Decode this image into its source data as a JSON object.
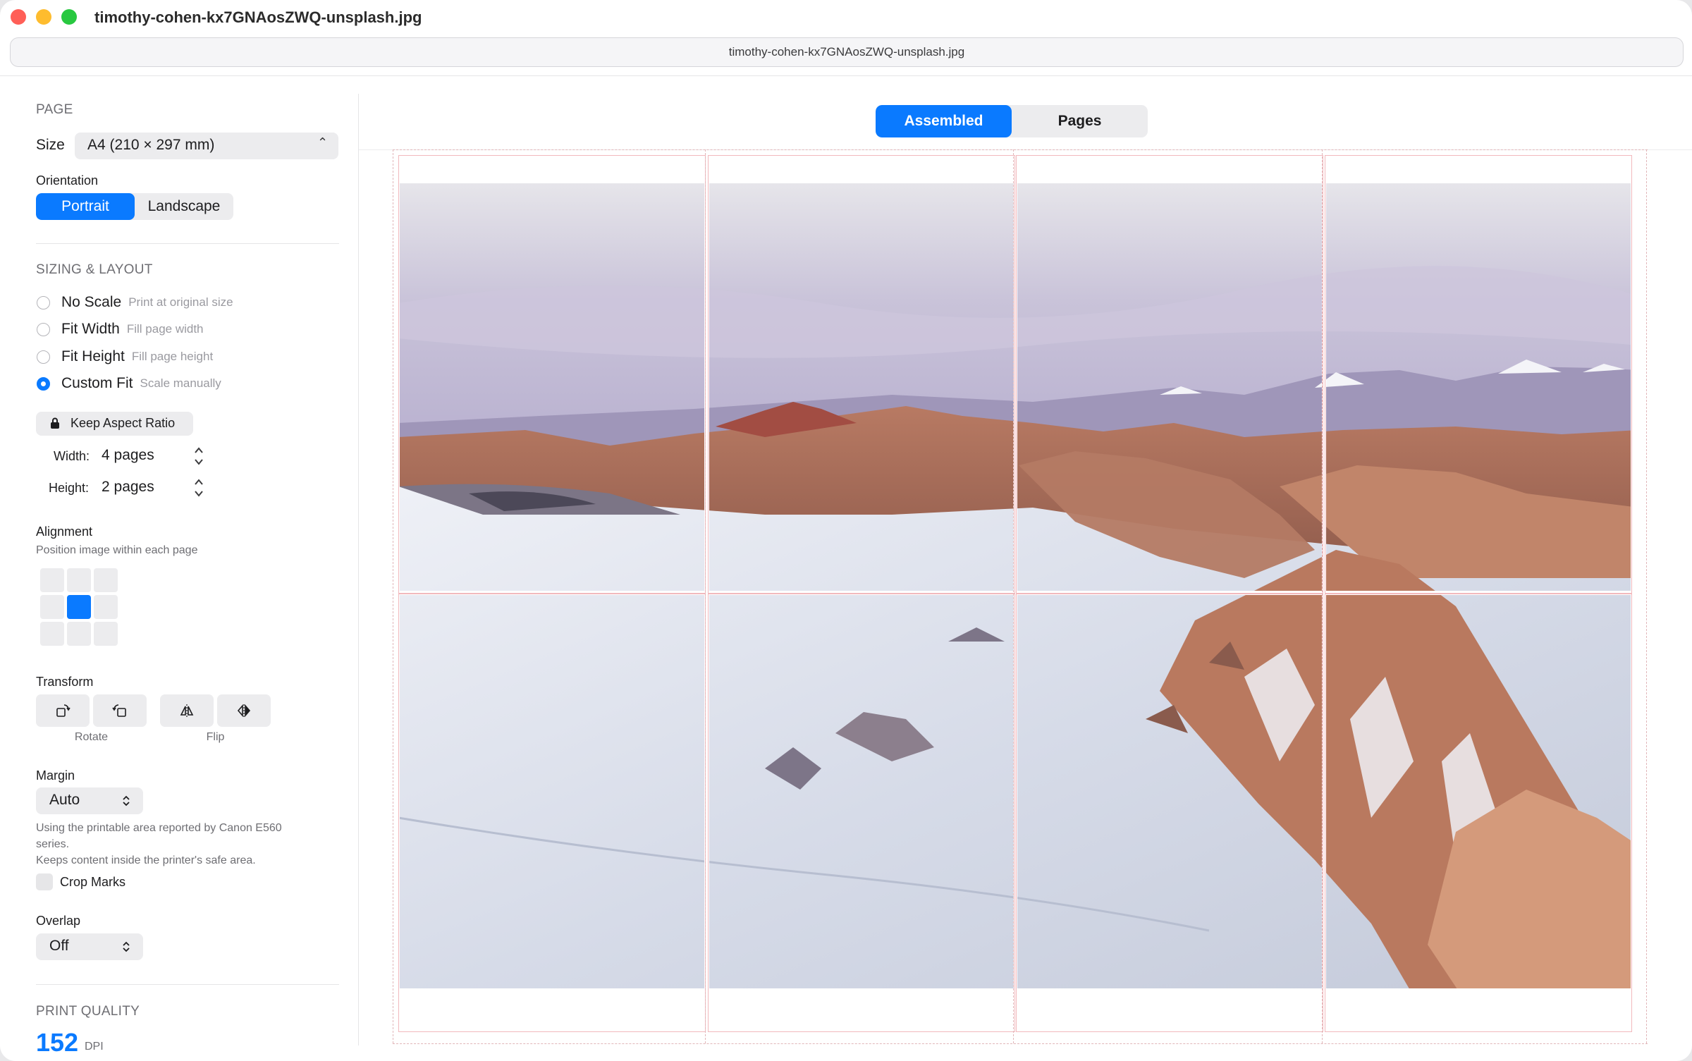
{
  "window": {
    "title": "timothy-cohen-kx7GNAosZWQ-unsplash.jpg",
    "path": "timothy-cohen-kx7GNAosZWQ-unsplash.jpg"
  },
  "sidebar": {
    "page_section": "PAGE",
    "size_label": "Size",
    "size_value": "A4 (210 × 297 mm)",
    "orientation_label": "Orientation",
    "orientation_options": [
      "Portrait",
      "Landscape"
    ],
    "orientation_selected": "Portrait",
    "sizing_section": "SIZING & LAYOUT",
    "scale_options": [
      {
        "label": "No Scale",
        "sub": "Print at original size",
        "selected": false
      },
      {
        "label": "Fit Width",
        "sub": "Fill page width",
        "selected": false
      },
      {
        "label": "Fit Height",
        "sub": "Fill page height",
        "selected": false
      },
      {
        "label": "Custom Fit",
        "sub": "Scale manually",
        "selected": true
      }
    ],
    "keep_aspect_label": "Keep Aspect Ratio",
    "width_label": "Width:",
    "width_value": "4 pages",
    "height_label": "Height:",
    "height_value": "2 pages",
    "alignment_label": "Alignment",
    "alignment_sub": "Position image within each page",
    "alignment_selected": "center",
    "transform_label": "Transform",
    "rotate_caption": "Rotate",
    "flip_caption": "Flip",
    "margin_label": "Margin",
    "margin_value": "Auto",
    "margin_note1": "Using the printable area reported by Canon E560 series.",
    "margin_note2": "Keeps content inside the printer's safe area.",
    "crop_marks_label": "Crop Marks",
    "crop_marks_checked": false,
    "overlap_label": "Overlap",
    "overlap_value": "Off",
    "print_quality_section": "PRINT QUALITY",
    "dpi_value": "152",
    "dpi_unit": "DPI"
  },
  "main": {
    "view_tabs": [
      "Assembled",
      "Pages"
    ],
    "view_selected": "Assembled",
    "grid": {
      "columns": 4,
      "rows": 2
    }
  },
  "colors": {
    "accent": "#0a7aff",
    "page_border": "#f2b9bd"
  }
}
